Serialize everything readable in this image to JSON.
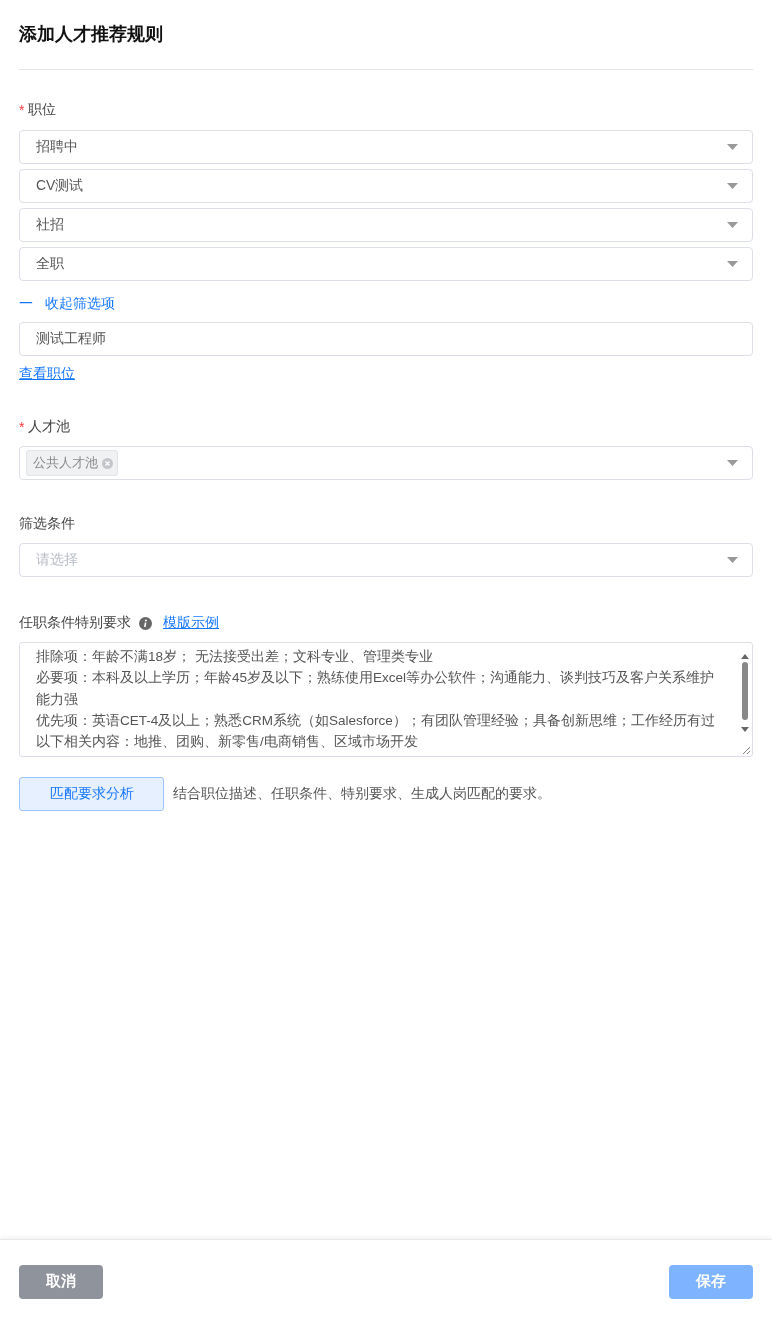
{
  "title": "添加人才推荐规则",
  "position": {
    "label": "职位",
    "required_mark": "*",
    "selects": [
      {
        "value": "招聘中"
      },
      {
        "value": "CV测试"
      },
      {
        "value": "社招"
      },
      {
        "value": "全职"
      }
    ],
    "collapse_link": {
      "icon": "一",
      "label": "收起筛选项"
    },
    "keyword": {
      "value": "测试工程师"
    },
    "view_link": "查看职位"
  },
  "talent_pool": {
    "label": "人才池",
    "required_mark": "*",
    "tags": [
      "公共人才池"
    ]
  },
  "filter": {
    "label": "筛选条件",
    "placeholder": "请选择"
  },
  "requirements": {
    "label": "任职条件特别要求",
    "template_link": "模版示例",
    "paragraphs": [
      "排除项：年龄不满18岁； 无法接受出差；文科专业、管理类专业",
      "必要项：本科及以上学历；年龄45岁及以下；熟练使用Excel等办公软件；沟通能力、谈判技巧及客户关系维护能力强",
      "优先项：英语CET-4及以上；熟悉CRM系统（如Salesforce）；有团队管理经验；具备创新思维；工作经历有过以下相关内容：地推、团购、新零售/电商销售、区域市场开发"
    ]
  },
  "analyze": {
    "button": "匹配要求分析",
    "hint": "结合职位描述、任职条件、特别要求、生成人岗匹配的要求。"
  },
  "footer": {
    "cancel": {
      "label": "取消",
      "disabled": false
    },
    "save": {
      "label": "保存",
      "disabled": true
    }
  }
}
